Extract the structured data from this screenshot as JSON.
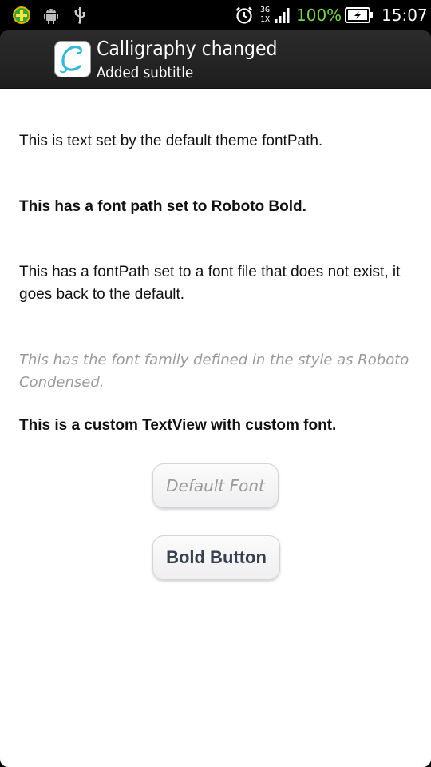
{
  "status_bar": {
    "battery_percent": "100%",
    "time": "15:07",
    "network_top": "3G",
    "network_bottom": "1X",
    "icons": [
      "notification-plus-icon",
      "android-debug-icon",
      "usb-icon",
      "alarm-icon",
      "signal-icon",
      "battery-charging-icon"
    ],
    "battery_color": "#7ad14a"
  },
  "action_bar": {
    "title": "Calligraphy changed",
    "subtitle": "Added subtitle",
    "app_icon": "calligraphy-c-icon"
  },
  "content": {
    "text_default": "This is text set by the default theme fontPath.",
    "text_roboto_bold": "This has a font path set to Roboto Bold.",
    "text_missing_font": "This has a fontPath set to a font file that does not exist, it goes back to the default.",
    "text_roboto_condensed": "This has the font family defined in the style as Roboto Condensed.",
    "text_custom_textview": "This is a custom TextView with custom font.",
    "button_default_font": "Default Font",
    "button_bold": "Bold Button"
  },
  "colors": {
    "action_bar_bg": "#222222",
    "content_bg": "#ffffff",
    "light_text": "#9a9a9a",
    "bold_button_text": "#36404f"
  }
}
